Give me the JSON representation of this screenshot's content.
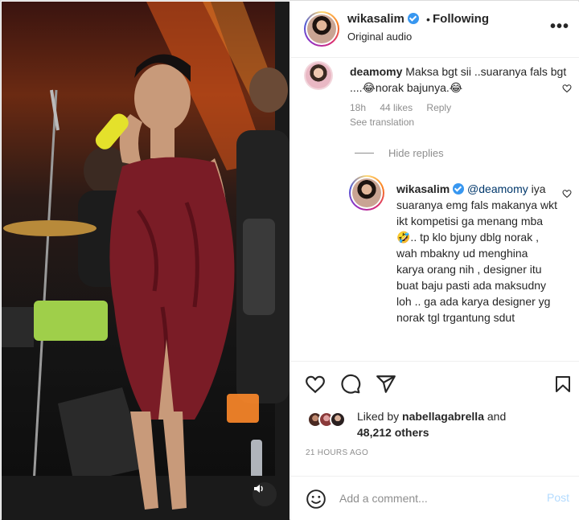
{
  "post": {
    "username": "wikasalim",
    "separator": "•",
    "follow_status": "Following",
    "audio_label": "Original audio",
    "more_label": "•••"
  },
  "comment1": {
    "username": "deamomy",
    "text": "Maksa bgt sii ..suaranya fals bgt ....😂norak bajunya.😂",
    "time": "18h",
    "likes": "44 likes",
    "reply_label": "Reply",
    "see_translation": "See translation",
    "hide_replies": "Hide replies"
  },
  "reply1": {
    "username": "wikasalim",
    "mention": "@deamomy",
    "text": "iya suaranya emg fals makanya wkt ikt kompetisi ga menang mba🤣.. tp klo bjuny dblg norak , wah mbakny ud menghina karya orang nih , designer itu buat baju pasti ada maksudny loh .. ga ada karya designer yg norak tgl trgantung sdut"
  },
  "likes": {
    "prefix": "Liked by",
    "user": "nabellagabrella",
    "and": "and",
    "others": "48,212 others"
  },
  "timestamp": "21 HOURS AGO",
  "comment_box": {
    "placeholder": "Add a comment...",
    "post_label": "Post"
  },
  "colors": {
    "verified": "#3897f0",
    "post_disabled": "#b3dbff",
    "dress": "#7a1c26",
    "mic": "#e4e12b"
  },
  "icons": [
    "verified-badge-icon",
    "more-options-icon",
    "heart-icon",
    "comment-icon",
    "share-icon",
    "bookmark-icon",
    "emoji-icon",
    "sound-icon"
  ]
}
